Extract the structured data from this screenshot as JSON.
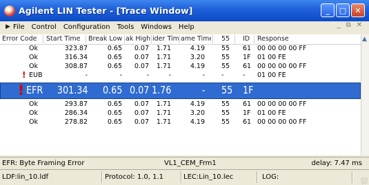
{
  "window": {
    "title": "Agilent LIN Tester - [Trace Window]",
    "minimize": "_",
    "maximize": "□",
    "close": "✕"
  },
  "menu": {
    "items": [
      "File",
      "Control",
      "Configuration",
      "Tools",
      "Windows",
      "Help"
    ],
    "mdi_minimize": "_",
    "mdi_restore": "⧉",
    "mdi_close": "✕"
  },
  "table": {
    "headers": [
      "Error Code",
      "Start Time",
      "Break Low",
      "ak High",
      "ider Time",
      "ame Time",
      "55",
      "ID",
      "Response"
    ],
    "rows": [
      {
        "error": "Ok",
        "start": "323.87",
        "break_low": "0.65",
        "break_high": "0.07",
        "header_time": "1.71",
        "frame_time": "4.19",
        "sync": "55",
        "id": "61",
        "response": "00 00 00 00 FF",
        "warn": false,
        "selected": false
      },
      {
        "error": "Ok",
        "start": "316.34",
        "break_low": "0.65",
        "break_high": "0.07",
        "header_time": "1.71",
        "frame_time": "3.20",
        "sync": "55",
        "id": "1F",
        "response": "01 00 FE",
        "warn": false,
        "selected": false
      },
      {
        "error": "Ok",
        "start": "308.87",
        "break_low": "0.65",
        "break_high": "0.07",
        "header_time": "1.71",
        "frame_time": "4.19",
        "sync": "55",
        "id": "61",
        "response": "00 00 00 00 FF",
        "warn": false,
        "selected": false
      },
      {
        "error": "EUB",
        "start": "-",
        "break_low": "-",
        "break_high": "-",
        "header_time": "-",
        "frame_time": "-",
        "sync": "-",
        "id": "-",
        "response": "01 00 FE",
        "warn": true,
        "selected": false
      },
      {
        "error": "EFR",
        "start": "301.34",
        "break_low": "0.65",
        "break_high": "0.07",
        "header_time": "1.76",
        "frame_time": "-",
        "sync": "55",
        "id": "1F",
        "response": "",
        "warn": true,
        "selected": true
      },
      {
        "error": "Ok",
        "start": "293.87",
        "break_low": "0.65",
        "break_high": "0.07",
        "header_time": "1.71",
        "frame_time": "4.19",
        "sync": "55",
        "id": "61",
        "response": "00 00 00 00 FF",
        "warn": false,
        "selected": false
      },
      {
        "error": "Ok",
        "start": "286.34",
        "break_low": "0.65",
        "break_high": "0.07",
        "header_time": "1.71",
        "frame_time": "3.20",
        "sync": "55",
        "id": "1F",
        "response": "01 00 FE",
        "warn": false,
        "selected": false
      },
      {
        "error": "Ok",
        "start": "278.82",
        "break_low": "0.65",
        "break_high": "0.07",
        "header_time": "1.71",
        "frame_time": "4.19",
        "sync": "55",
        "id": "61",
        "response": "00 00 00 00 FF",
        "warn": false,
        "selected": false
      }
    ],
    "warn_icon": "!"
  },
  "status": {
    "error_desc": "EFR: Byte Framing Error",
    "frame_name": "VL1_CEM_Frm1",
    "delay": "delay: 7.47 ms",
    "ldf": "LDF:lin_10.ldf",
    "protocol": "Protocol: 1.0, 1.1",
    "lec": "LEC:Lin_10.lec",
    "log": "LOG:"
  },
  "icons": {
    "app": "agilent-logo-icon",
    "menu_arrow": "play-arrow-icon",
    "warning": "exclamation-icon",
    "scroll_up": "chevron-up-icon"
  }
}
